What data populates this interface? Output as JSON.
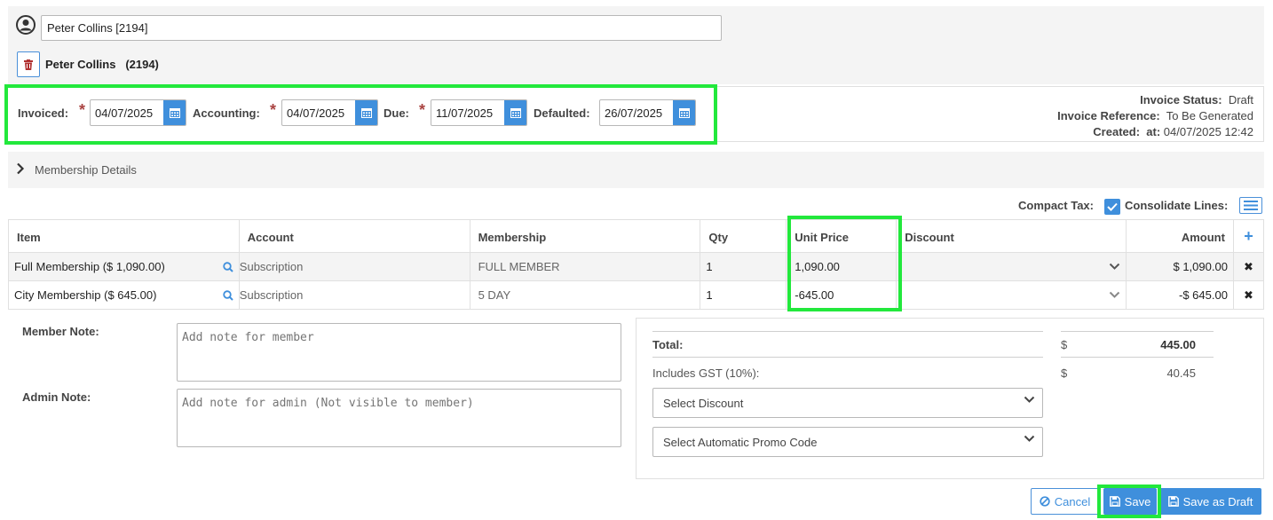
{
  "member": {
    "search_value": "Peter Collins [2194]",
    "name": "Peter Collins",
    "id": "(2194)"
  },
  "dates": {
    "invoiced_label": "Invoiced:",
    "invoiced_value": "04/07/2025",
    "accounting_label": "Accounting:",
    "accounting_value": "04/07/2025",
    "due_label": "Due:",
    "due_value": "11/07/2025",
    "defaulted_label": "Defaulted:",
    "defaulted_value": "26/07/2025",
    "required_mark": "*"
  },
  "invoice_info": {
    "status_label": "Invoice Status:",
    "status_value": "Draft",
    "reference_label": "Invoice Reference:",
    "reference_value": "To Be Generated",
    "created_label": "Created:",
    "created_at_label": "at:",
    "created_value": "04/07/2025 12:42"
  },
  "membership_details": {
    "label": "Membership Details"
  },
  "options": {
    "compact_tax_label": "Compact Tax:",
    "compact_tax_checked": true,
    "consolidate_label": "Consolidate Lines:"
  },
  "table": {
    "headers": {
      "item": "Item",
      "account": "Account",
      "membership": "Membership",
      "qty": "Qty",
      "unit_price": "Unit Price",
      "discount": "Discount",
      "amount": "Amount",
      "add": "+"
    },
    "rows": [
      {
        "item": "Full Membership ($ 1,090.00)",
        "account": "Subscription",
        "membership": "FULL MEMBER",
        "qty": "1",
        "unit_price": "1,090.00",
        "amount": "$ 1,090.00",
        "remove": "✖"
      },
      {
        "item": "City Membership ($ 645.00)",
        "account": "Subscription",
        "membership": "5 DAY",
        "qty": "1",
        "unit_price": "-645.00",
        "amount": "-$ 645.00",
        "remove": "✖"
      }
    ]
  },
  "notes": {
    "member_label": "Member Note:",
    "member_placeholder": "Add note for member",
    "admin_label": "Admin Note:",
    "admin_placeholder": "Add note for admin (Not visible to member)"
  },
  "totals": {
    "total_label": "Total:",
    "currency": "$",
    "total_value": "445.00",
    "gst_label": "Includes GST (10%):",
    "gst_value": "40.45",
    "discount_select": "Select Discount",
    "promo_select": "Select Automatic Promo Code"
  },
  "buttons": {
    "cancel": "Cancel",
    "save": "Save",
    "save_draft": "Save as Draft"
  },
  "colors": {
    "accent": "#3f8fdc",
    "highlight": "#22e83c",
    "danger": "#b03030"
  }
}
